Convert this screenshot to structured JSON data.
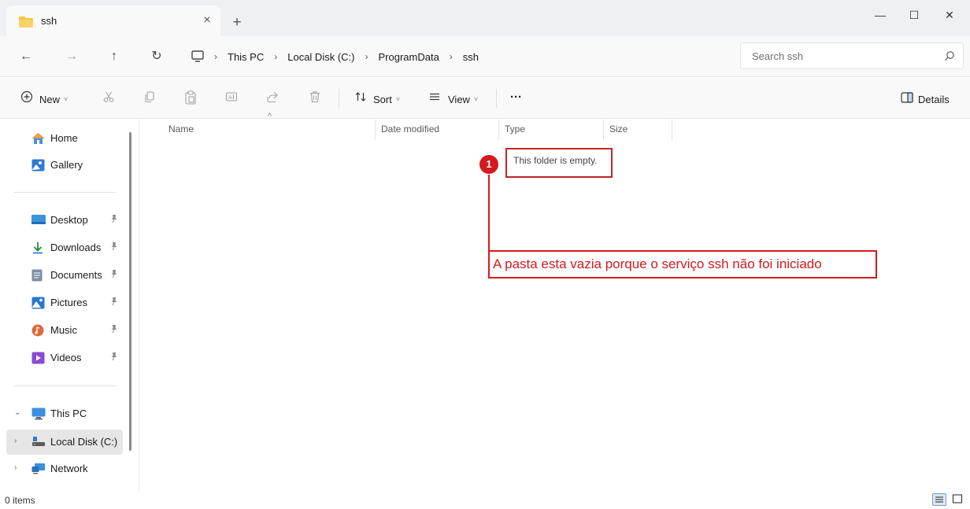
{
  "window": {
    "tab_title": "ssh",
    "tab_close_glyph": "×",
    "new_tab_glyph": "+",
    "minimize_glyph": "—",
    "maximize_glyph": "☐",
    "close_glyph": "✕"
  },
  "navigation": {
    "back_glyph": "←",
    "forward_glyph": "→",
    "up_glyph": "↑",
    "refresh_glyph": "↻",
    "breadcrumbs": [
      "This PC",
      "Local Disk (C:)",
      "ProgramData",
      "ssh"
    ],
    "separator": "›",
    "search_placeholder": "Search ssh"
  },
  "toolbar": {
    "new_label": "New",
    "sort_label": "Sort",
    "view_label": "View",
    "more_label": "···",
    "details_label": "Details",
    "chevron": "˅"
  },
  "sidebar": {
    "items": [
      {
        "label": "Home",
        "icon": "home-icon"
      },
      {
        "label": "Gallery",
        "icon": "gallery-icon"
      },
      {
        "label": "Desktop",
        "icon": "desktop-icon",
        "pinned": true
      },
      {
        "label": "Downloads",
        "icon": "downloads-icon",
        "pinned": true
      },
      {
        "label": "Documents",
        "icon": "documents-icon",
        "pinned": true
      },
      {
        "label": "Pictures",
        "icon": "pictures-icon",
        "pinned": true
      },
      {
        "label": "Music",
        "icon": "music-icon",
        "pinned": true
      },
      {
        "label": "Videos",
        "icon": "videos-icon",
        "pinned": true
      },
      {
        "label": "This PC",
        "icon": "this-pc-icon",
        "expanded": true
      },
      {
        "label": "Local Disk (C:)",
        "icon": "local-disk-icon",
        "selected": true
      },
      {
        "label": "Network",
        "icon": "network-icon"
      }
    ],
    "expand_open_glyph": "⌄",
    "expand_closed_glyph": "›"
  },
  "file_list": {
    "columns": [
      "Name",
      "Date modified",
      "Type",
      "Size"
    ],
    "sort_indicator": "^",
    "empty_message": "This folder is empty."
  },
  "annotation": {
    "badge_number": "1",
    "text": "A pasta esta vazia porque o serviço ssh não foi iniciado",
    "color": "#d4191f"
  },
  "status": {
    "item_count": "0 items"
  },
  "colors": {
    "titlebar_bg": "#eef0f3",
    "chrome_bg": "#f9f9f9",
    "folder_yellow": "#f4c542",
    "accent_blue": "#1e6fd9",
    "annotation_red": "#d4191f"
  }
}
